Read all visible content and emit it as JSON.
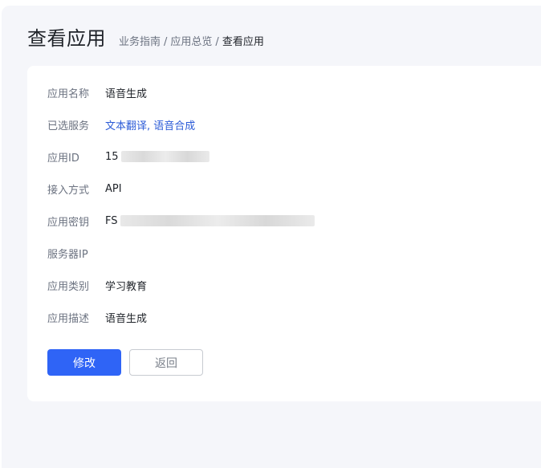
{
  "header": {
    "title": "查看应用",
    "breadcrumb": [
      "业务指南",
      "应用总览",
      "查看应用"
    ],
    "separator": "/"
  },
  "app": {
    "fields": [
      {
        "label": "应用名称",
        "value": "语音生成"
      },
      {
        "label": "已选服务",
        "services": [
          "文本翻译",
          "语音合成"
        ],
        "separator": ","
      },
      {
        "label": "应用ID",
        "visible_prefix": "15",
        "masked": true
      },
      {
        "label": "接入方式",
        "value": "API"
      },
      {
        "label": "应用密钥",
        "visible_prefix": "FS",
        "masked": true
      },
      {
        "label": "服务器IP",
        "value": ""
      },
      {
        "label": "应用类别",
        "value": "学习教育"
      },
      {
        "label": "应用描述",
        "value": "语音生成"
      }
    ]
  },
  "actions": {
    "primary_label": "修改",
    "secondary_label": "返回"
  },
  "colors": {
    "page_background": "#f5f6fa",
    "card_background": "#ffffff",
    "primary": "#2f64f6",
    "link": "#2b5bd7",
    "label": "#6b7280",
    "text": "#1f2329"
  }
}
